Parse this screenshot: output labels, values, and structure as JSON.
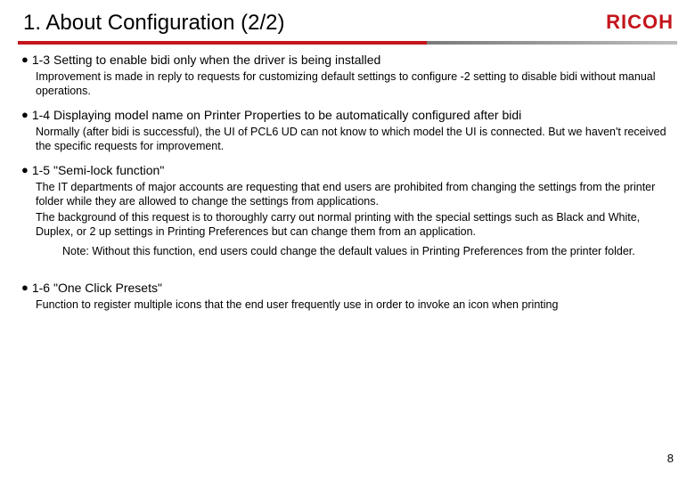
{
  "header": {
    "title": "1. About Configuration (2/2)",
    "logo_text": "RICOH"
  },
  "items": [
    {
      "bullet": "●",
      "title": "1-3 Setting to enable bidi only when the driver is being installed",
      "body": "Improvement is made in reply to requests for customizing default settings to configure -2 setting to disable bidi without manual operations."
    },
    {
      "bullet": "●",
      "title": "1-4 Displaying model name on Printer Properties to be automatically configured after bidi",
      "body": "Normally (after bidi is successful), the UI of PCL6 UD can not know to which model the UI is connected. But we haven't received the specific requests for improvement."
    },
    {
      "bullet": "●",
      "title": "1-5 \"Semi-lock function\"",
      "body_p1": "The IT departments of major accounts are requesting that end users are prohibited from changing the settings from the printer folder while they are allowed to change the settings from applications.",
      "body_p2": "The background of this request is to thoroughly carry out normal printing with the special settings such as Black and White, Duplex, or 2 up settings in Printing Preferences but can change them from an application.",
      "note": "Note: Without this function, end users could change the default values in Printing Preferences from the printer folder."
    },
    {
      "bullet": "●",
      "title": "1-6 \"One Click Presets\"",
      "body": "Function to register multiple icons that the end user frequently use in order to invoke an icon when printing"
    }
  ],
  "page_number": "8"
}
